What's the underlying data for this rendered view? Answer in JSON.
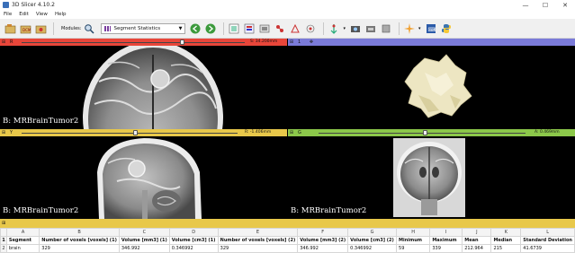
{
  "window": {
    "title": "3D Slicer 4.10.2",
    "min": "—",
    "max": "☐",
    "close": "✕"
  },
  "menu": [
    "File",
    "Edit",
    "View",
    "Help"
  ],
  "toolbar": {
    "modules_label": "Modules:",
    "module_selected": "Segment Statistics"
  },
  "views": {
    "red": {
      "letter": "R",
      "offset": "S: 34.200mm",
      "label": "B: MRBrainTumor2"
    },
    "yellow": {
      "letter": "Y",
      "offset": "R: -1.406mm",
      "label": "B: MRBrainTumor2"
    },
    "green": {
      "letter": "G",
      "offset": "A: 0.469mm",
      "label": "B: MRBrainTumor2"
    },
    "three_d": {
      "letter": "1"
    }
  },
  "table": {
    "columns": [
      "A",
      "B",
      "C",
      "D",
      "E",
      "F",
      "G",
      "H",
      "I",
      "J",
      "K",
      "L"
    ],
    "header": [
      "Segment",
      "Number of voxels [voxels] (1)",
      "Volume [mm3] (1)",
      "Volume [cm3] (1)",
      "Number of voxels [voxels] (2)",
      "Volume [mm3] (2)",
      "Volume [cm3] (2)",
      "Minimum",
      "Maximum",
      "Mean",
      "Median",
      "Standard Deviation"
    ],
    "rows": [
      [
        "brain",
        "329",
        "346.992",
        "0.346992",
        "329",
        "346.992",
        "0.346992",
        "59",
        "339",
        "212.964",
        "215",
        "41.6739"
      ]
    ],
    "row_numbers": [
      "1",
      "2"
    ]
  },
  "colors": {
    "red": "#e8463a",
    "yellow": "#e8c84a",
    "green": "#8cc84a",
    "blue3d": "#7a7ad8",
    "tumor": "#ede6c2"
  }
}
